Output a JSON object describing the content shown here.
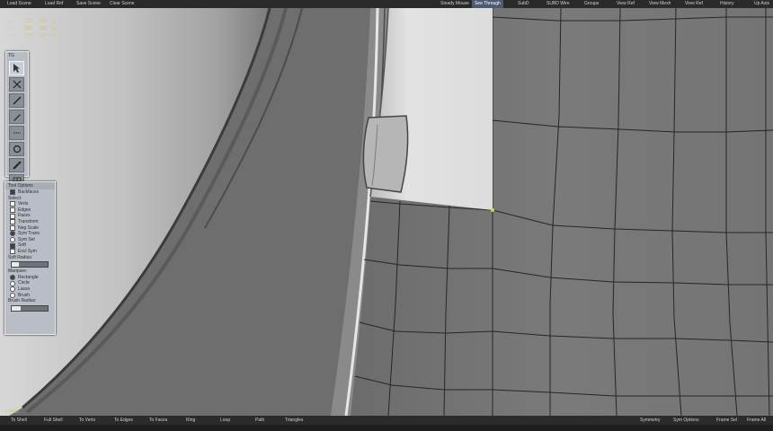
{
  "toolbar": {
    "load_scene": "Load Scene",
    "load_ref": "Load Ref",
    "save_scene": "Save Scene",
    "clear_scene": "Clear Scene",
    "steady_mouse": "Steady Mouse",
    "see_through": "See Through",
    "subd": "SubD",
    "subd_wire": "SUBD Wire",
    "groups": "Groups",
    "view_ref": "View Ref",
    "view_mesh": "View Mesh",
    "view_ref2": "View Ref",
    "history": "History",
    "up_axis": "Up Axis"
  },
  "stats": {
    "headers": [
      "",
      "Num",
      "Vis",
      "Sel"
    ],
    "rows": [
      {
        "label": "Verts",
        "num": "225",
        "vis": "225",
        "sel": "1"
      },
      {
        "label": "Edges",
        "num": "392",
        "vis": "392",
        "sel": "0"
      },
      {
        "label": "Faces",
        "num": "170",
        "vis": "170",
        "sel": "0"
      }
    ]
  },
  "tg_panel": {
    "title": "TG",
    "tools": [
      "select-arrow-icon",
      "cut-icon",
      "knife-icon",
      "pencil-icon",
      "link-icon",
      "grab-icon",
      "brush-icon",
      "mesh-icon"
    ]
  },
  "tool_options": {
    "title": "Tool Options",
    "backfaces": "Backfaces",
    "select_label": "Select:",
    "select_items": [
      "Verts",
      "Edges",
      "Faces"
    ],
    "transform_items": [
      "Transform",
      "Neg Scale",
      "Sym Trans",
      "Sym Sel",
      "Soft",
      "Excl Sym"
    ],
    "soft_radius_label": "Soft Radius:",
    "soft_radius_value": "1.00",
    "marquee_label": "Marquee:",
    "marquee_items": [
      "Rectangle",
      "Circle",
      "Lasso",
      "Brush"
    ],
    "brush_radius_label": "Brush Radius:",
    "brush_radius_value": "1.00",
    "soft_radius_fill": 0.2,
    "brush_radius_fill": 0.25
  },
  "bottombar": {
    "to_shell": "To Shell",
    "full_shell": "Full Shell",
    "to_verts": "To Verts",
    "to_edges": "To Edges",
    "to_faces": "To Faces",
    "ring": "Ring",
    "loop": "Loop",
    "path": "Path",
    "triangles": "Triangles",
    "symmetry": "Symmetry",
    "sym_options": "Sym Options",
    "frame_sel": "Frame Sel",
    "frame_all": "Frame All"
  },
  "coord_readout": "13480",
  "colors": {
    "topbar": "#2a2a2a",
    "active_button": "#4d5a74",
    "stats_text": "#d8c36a",
    "panel_bg": "#b9bdc5",
    "mesh_face": "#7a7a7a",
    "reference_surface": "#d8d8d8"
  }
}
